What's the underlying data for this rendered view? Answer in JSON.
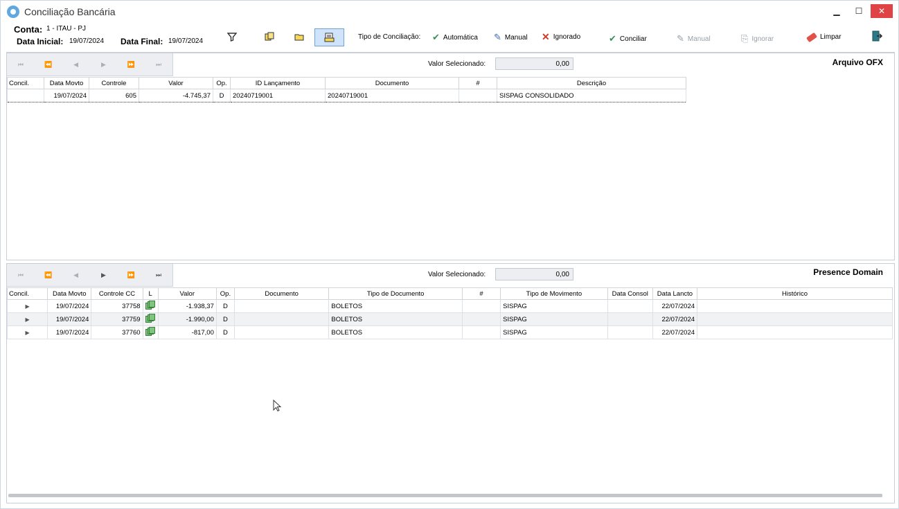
{
  "window": {
    "title": "Conciliação Bancária",
    "minimize": "▁",
    "maximize": "☐",
    "close": "✕"
  },
  "header": {
    "conta_label": "Conta:",
    "conta_value": "1 - ITAU - PJ",
    "data_inicial_label": "Data Inicial:",
    "data_inicial_value": "19/07/2024",
    "data_final_label": "Data Final:",
    "data_final_value": "19/07/2024",
    "tipo_label": "Tipo de Conciliação:",
    "tipo_automatica": "Automática",
    "tipo_manual": "Manual",
    "tipo_ignorado": "Ignorado",
    "conciliar": "Conciliar",
    "manual_action": "Manual",
    "ignorar": "Ignorar",
    "limpar": "Limpar"
  },
  "ofx_panel": {
    "title": "Arquivo OFX",
    "valor_label": "Valor Selecionado:",
    "valor_value": "0,00",
    "columns": [
      "Concil.",
      "Data Movto",
      "Controle",
      "Valor",
      "Op.",
      "ID Lançamento",
      "Documento",
      "#",
      "Descrição"
    ],
    "rows": [
      [
        "",
        "19/07/2024",
        "605",
        "-4.745,37",
        "D",
        "20240719001",
        "20240719001",
        "",
        "SISPAG CONSOLIDADO"
      ]
    ]
  },
  "domain_panel": {
    "title": "Presence Domain",
    "valor_label": "Valor Selecionado:",
    "valor_value": "0,00",
    "columns": [
      "Concil.",
      "Data Movto",
      "Controle CC",
      "L",
      "Valor",
      "Op.",
      "Documento",
      "Tipo de Documento",
      "#",
      "Tipo de Movimento",
      "Data Consol",
      "Data Lancto",
      "Histórico"
    ],
    "rows": [
      [
        "",
        "19/07/2024",
        "37758",
        "",
        "-1.938,37",
        "D",
        "",
        "BOLETOS",
        "",
        "SISPAG",
        "",
        "22/07/2024",
        ""
      ],
      [
        "",
        "19/07/2024",
        "37759",
        "",
        "-1.990,00",
        "D",
        "",
        "BOLETOS",
        "",
        "SISPAG",
        "",
        "22/07/2024",
        ""
      ],
      [
        "",
        "19/07/2024",
        "37760",
        "",
        "-817,00",
        "D",
        "",
        "BOLETOS",
        "",
        "SISPAG",
        "",
        "22/07/2024",
        ""
      ]
    ]
  },
  "nav": {
    "first": "⏮",
    "prev_page": "⏪",
    "prev": "◀",
    "next": "▶",
    "next_page": "⏩",
    "last": "⏭"
  },
  "colors": {
    "accent": "#cfe4fa",
    "close": "#e04343",
    "icon_green": "#7fc47f"
  },
  "icons": [
    "filter-icon",
    "copy-icon",
    "folder-icon",
    "report-icon",
    "check-icon",
    "edit-icon",
    "x-icon",
    "eraser-icon",
    "exit-icon"
  ]
}
